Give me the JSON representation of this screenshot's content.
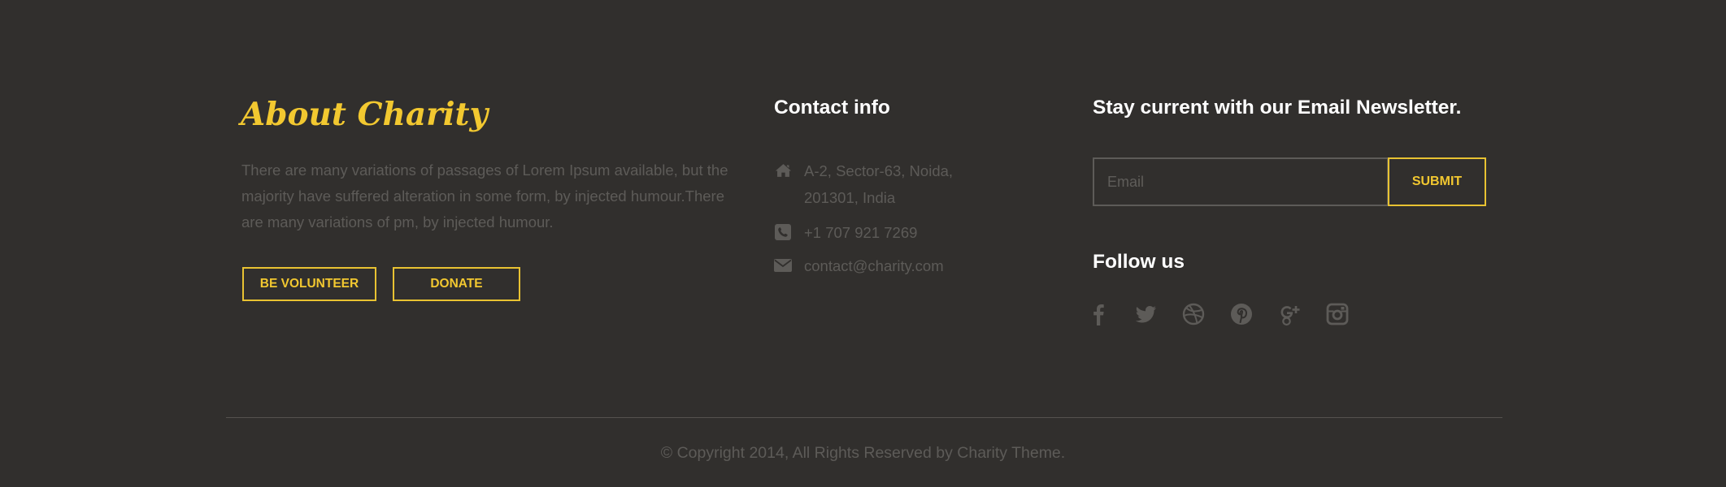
{
  "about": {
    "title": "About Charity",
    "text": "There are many variations of passages of Lorem Ipsum available, but the majority have suffered alteration in some form, by injected humour.There are many variations of pm, by injected humour.",
    "volunteer_label": "BE VOLUNTEER",
    "donate_label": "DONATE"
  },
  "contact": {
    "title": "Contact info",
    "address": "A-2, Sector-63, Noida,\n201301, India",
    "phone": "+1 707 921 7269",
    "email": "contact@charity.com",
    "icons": [
      "home-icon",
      "phone-icon",
      "envelope-icon"
    ]
  },
  "newsletter": {
    "title": "Stay current with our Email Newsletter.",
    "email_placeholder": "Email",
    "email_value": "",
    "submit_label": "SUBMIT"
  },
  "follow": {
    "title": "Follow us",
    "icons": [
      "facebook-icon",
      "twitter-icon",
      "dribbble-icon",
      "pinterest-icon",
      "google-plus-icon",
      "instagram-icon"
    ]
  },
  "footer": {
    "copyright": "© Copyright 2014, All Rights Reserved by Charity Theme."
  },
  "colors": {
    "background": "#312f2d",
    "accent": "#f2c830",
    "muted_text": "#5d5b58",
    "heading": "#ffffff"
  }
}
